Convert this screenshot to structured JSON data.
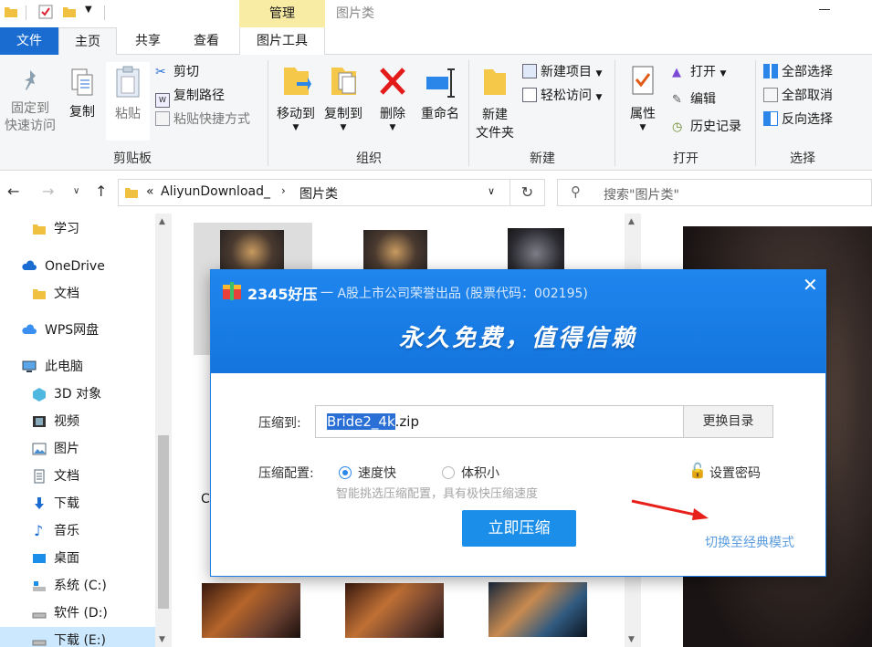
{
  "window": {
    "manage_tab": "管理",
    "title": "图片类"
  },
  "tabs": {
    "file": "文件",
    "home": "主页",
    "share": "共享",
    "view": "查看",
    "picture_tools": "图片工具"
  },
  "ribbon": {
    "pin_quick_access": "固定到\n快速访问",
    "copy": "复制",
    "paste": "粘贴",
    "cut": "剪切",
    "copy_path": "复制路径",
    "paste_shortcut": "粘贴快捷方式",
    "clipboard_group": "剪贴板",
    "move_to": "移动到",
    "copy_to": "复制到",
    "delete": "删除",
    "rename": "重命名",
    "organize_group": "组织",
    "new_folder": "新建\n文件夹",
    "new_item": "新建项目",
    "easy_access": "轻松访问",
    "new_group": "新建",
    "properties": "属性",
    "open": "打开",
    "edit": "编辑",
    "history": "历史记录",
    "open_group": "打开",
    "select_all": "全部选择",
    "select_none": "全部取消",
    "invert_selection": "反向选择",
    "select_group": "选择"
  },
  "address": {
    "path_prefix": "«",
    "path_part1": "AliyunDownload_",
    "path_part2": "图片类",
    "search_placeholder": "搜索\"图片类\""
  },
  "nav": {
    "items": [
      {
        "label": "学习"
      },
      {
        "label": "OneDrive"
      },
      {
        "label": "文档"
      },
      {
        "label": "WPS网盘"
      },
      {
        "label": "此电脑"
      },
      {
        "label": "3D 对象"
      },
      {
        "label": "视频"
      },
      {
        "label": "图片"
      },
      {
        "label": "文档"
      },
      {
        "label": "下载"
      },
      {
        "label": "音乐"
      },
      {
        "label": "桌面"
      },
      {
        "label": "系统 (C:)"
      },
      {
        "label": "软件 (D:)"
      },
      {
        "label": "下载 (E:)"
      }
    ]
  },
  "content": {
    "partial_label": "C"
  },
  "dialog": {
    "brand": "2345好压",
    "subtitle": "一 A股上市公司荣誉出品 (股票代码：002195)",
    "slogan": "永久免费，值得信赖",
    "compress_to_label": "压缩到:",
    "filename_selected": "Bride2_4k",
    "filename_ext": ".zip",
    "change_dir": "更换目录",
    "config_label": "压缩配置:",
    "opt_fast": "速度快",
    "opt_small": "体积小",
    "set_password": "设置密码",
    "hint": "智能挑选压缩配置，具有极快压缩速度",
    "compress_now": "立即压缩",
    "switch_classic": "切换至经典模式"
  },
  "colors": {
    "accent": "#1a6cd1",
    "dialog_blue": "#1a8ee8",
    "manage_tab": "#f8eba4",
    "arrow_red": "#e8201b"
  }
}
